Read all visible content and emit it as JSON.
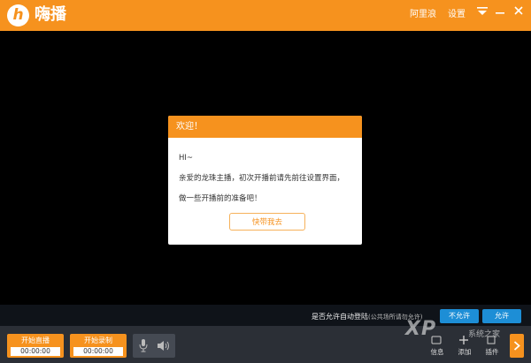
{
  "app": {
    "logo_glyph": "h",
    "name": "嗨播"
  },
  "titlebar": {
    "username": "阿里浪",
    "settings_label": "设置"
  },
  "dialog": {
    "title": "欢迎！",
    "lines": [
      "HI~",
      "亲爱的龙珠主播，初次开播前请先前往设置界面，",
      "做一些开播前的准备吧！"
    ],
    "button_label": "快带我去"
  },
  "allow_bar": {
    "question": "是否允许自动登陆",
    "note": "(公共场所请勿允许)",
    "deny_label": "不允许",
    "allow_label": "允许"
  },
  "controls": {
    "live": {
      "label": "开始直播",
      "time": "00:00:00"
    },
    "record": {
      "label": "开始录制",
      "time": "00:00:00"
    }
  },
  "tools": [
    {
      "label": "信息",
      "icon": "info-icon"
    },
    {
      "label": "添加",
      "icon": "add-icon"
    },
    {
      "label": "插件",
      "icon": "plugin-icon"
    }
  ],
  "watermark": {
    "text": "XP",
    "sub": "系统之家"
  },
  "colors": {
    "accent": "#f6921e",
    "blue": "#1d8ed6",
    "toolbar": "#2b2f36",
    "stage": "#000000"
  }
}
